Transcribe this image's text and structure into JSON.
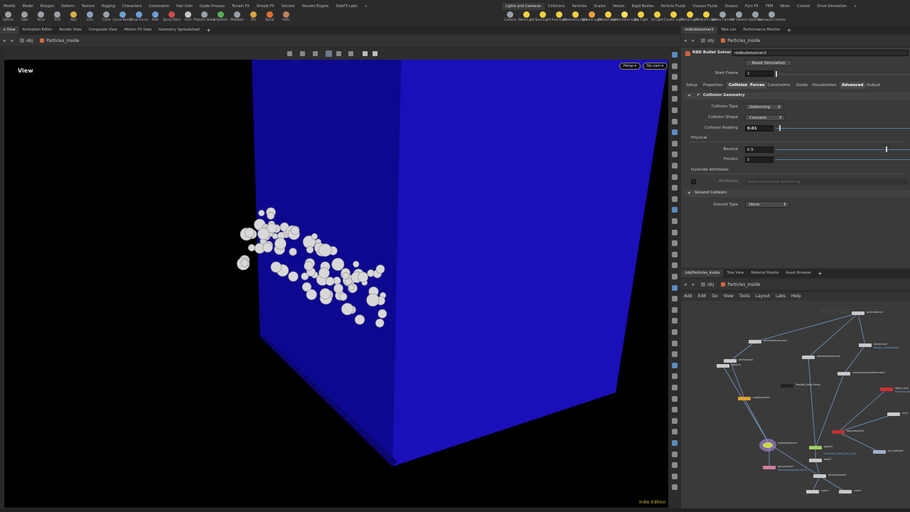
{
  "shelf_tabs_left": [
    "Modify",
    "Model",
    "Polygon",
    "Deform",
    "Texture",
    "Rigging",
    "Characters",
    "Constraints",
    "Hair Utils",
    "Guide Process",
    "Terrain FX",
    "Simple FX",
    "Volume",
    "Houdini Engine",
    "SideFX Labs",
    "+"
  ],
  "shelf_tabs_right": [
    "Lights and Cameras",
    "Collisions",
    "Particles",
    "Grains",
    "Vellum",
    "Rigid Bodies",
    "Particle Fluids",
    "Viscous Fluids",
    "Oceans",
    "Pyro FX",
    "FEM",
    "Wires",
    "Crowds",
    "Drive Simulation",
    "+"
  ],
  "tools_left": [
    {
      "label": "Sphere",
      "color": "#9aa0a8"
    },
    {
      "label": "Tube",
      "color": "#9aa0a8"
    },
    {
      "label": "Torus",
      "color": "#9aa0a8"
    },
    {
      "label": "Grid",
      "color": "#9aa0a8"
    },
    {
      "label": "Null",
      "color": "#d8b040"
    },
    {
      "label": "Line",
      "color": "#8aa0c0"
    },
    {
      "label": "Circle",
      "color": "#9aa0a8"
    },
    {
      "label": "Curve Bezier",
      "color": "#6aa0d0"
    },
    {
      "label": "Draw Curve",
      "color": "#6aa0d0"
    },
    {
      "label": "Path",
      "color": "#6aa0d0"
    },
    {
      "label": "Spray Paint",
      "color": "#d04a4a"
    },
    {
      "label": "Font",
      "color": "#c8c8c8"
    },
    {
      "label": "Platonic Solids",
      "color": "#9aa0a8"
    },
    {
      "label": "L-System",
      "color": "#5ab05a"
    },
    {
      "label": "Metaball",
      "color": "#9aa0a8"
    },
    {
      "label": "File",
      "color": "#d8a040"
    },
    {
      "label": "Spiral",
      "color": "#e07030"
    },
    {
      "label": "Helix",
      "color": "#c08060"
    }
  ],
  "tools_right": [
    {
      "label": "Camera",
      "color": "#9aa0a8"
    },
    {
      "label": "Point Light",
      "color": "#f0d040"
    },
    {
      "label": "Spot Light",
      "color": "#f0d040"
    },
    {
      "label": "Area Light",
      "color": "#f0d040"
    },
    {
      "label": "Geometry Light",
      "color": "#f0d040"
    },
    {
      "label": "Volume Light",
      "color": "#f0a040"
    },
    {
      "label": "Distant Light",
      "color": "#f0d040"
    },
    {
      "label": "Environment Light",
      "color": "#f0e060"
    },
    {
      "label": "Sky Light",
      "color": "#f0d040"
    },
    {
      "label": "GI Light",
      "color": "#f0d040"
    },
    {
      "label": "Caustic Light",
      "color": "#f0d040"
    },
    {
      "label": "Portal Light",
      "color": "#f0d040"
    },
    {
      "label": "Ambient Light",
      "color": "#f0d040"
    },
    {
      "label": "Stereo Camera",
      "color": "#9aa0a8"
    },
    {
      "label": "VR Camera",
      "color": "#9aa0a8"
    },
    {
      "label": "Switcher",
      "color": "#9aa0a8"
    },
    {
      "label": "Gamepad Camera",
      "color": "#9aa0a8"
    }
  ],
  "viewer_tabs": [
    "e View",
    "Animation Editor",
    "Render View",
    "Composite View",
    "Motion FX View",
    "Geometry Spreadsheet",
    "+"
  ],
  "viewer_path": [
    "obj",
    "Particles_Inside"
  ],
  "viewport": {
    "label": "View",
    "persp": "Persp ▾",
    "camera": "No cam ▾",
    "edition": "Indie Edition"
  },
  "param_tabs": [
    "rbdbulletsolver2",
    "Take List",
    "Performance Monitor",
    "+"
  ],
  "node_header": {
    "type": "RBD Bullet Solver",
    "name": "rbdbulletsolver2"
  },
  "params": {
    "reset_label": "Reset Simulation",
    "start_frame_label": "Start Frame",
    "start_frame": "1",
    "tabs": [
      "Setup",
      "Properties",
      "Collision",
      "Forces",
      "Constraints",
      "Guide",
      "Visualization",
      "Advanced",
      "Output"
    ],
    "collision_geometry": "Collision Geometry",
    "collision_type_label": "Collision Type",
    "collision_type": "Deforming",
    "collision_shape_label": "Collision Shape",
    "collision_shape": "Concave",
    "collision_padding_label": "Collision Padding",
    "collision_padding": "0.01",
    "physical_label": "Physical",
    "bounce_label": "Bounce",
    "bounce": "0.5",
    "bounce_fraction": 0.5,
    "friction_label": "Friction",
    "friction": "1",
    "override_label": "Override Attributes",
    "attributes_label": "Attributes",
    "attributes_value": "active animated deforming",
    "ground_collision": "Ground Collision",
    "ground_type_label": "Ground Type",
    "ground_type": "None"
  },
  "net_tabs": [
    "/obj/Particles_Inside",
    "Tree View",
    "Material Palette",
    "Asset Browser",
    "+"
  ],
  "net_path": [
    "obj",
    "Particles_Inside"
  ],
  "net_menu": [
    "Add",
    "Edit",
    "Go",
    "View",
    "Tools",
    "Layout",
    "Labs",
    "Help"
  ],
  "net_watermark": "Indie Ed",
  "nodes": [
    {
      "name": "pointdeform2",
      "color": "#c8c8c8",
      "note": ""
    },
    {
      "name": "pointsfromvolume1",
      "color": "#c8c8c8",
      "note": ""
    },
    {
      "name": "attribrand1",
      "color": "#c8c8c8",
      "note": "density_temperature"
    },
    {
      "name": "attribnoise2",
      "color": "#c8c8c8",
      "note": ""
    },
    {
      "name": "pointsfromvolume2",
      "color": "#c8c8c8",
      "note": ""
    },
    {
      "name": "sphere1",
      "color": "#c8c8c8",
      "note": ""
    },
    {
      "name": "volumerasterizeattributes1",
      "color": "#c8c8c8",
      "note": ""
    },
    {
      "name": "Tealight_Glow_Portal",
      "color": "#222222",
      "note": ""
    },
    {
      "name": "copytopoints2",
      "color": "#e0a030",
      "note": ""
    },
    {
      "name": "object_mer",
      "color": "#d03030",
      "note": "Pyramid_Inside"
    },
    {
      "name": "rbdbulletsolver2",
      "color": "#c8d850",
      "note": ""
    },
    {
      "name": "popnet",
      "color": "#a0d060",
      "note": "",
      "extra": "sub shoes_intro_first_input"
    },
    {
      "name": "dopnetsolver1",
      "color": "#c03030",
      "note": ""
    },
    {
      "name": "out_subtract",
      "color": "#a0b0c8",
      "note": ""
    },
    {
      "name": "blast1",
      "color": "#c8c8c8",
      "note": ""
    },
    {
      "name": "attributenoise1",
      "color": "#c8c8c8",
      "note": ""
    },
    {
      "name": "rop_alembic1",
      "color": "#d080a0",
      "note": "Simulation/sphere-fluids-..."
    },
    {
      "name": "color1",
      "color": "#c8c8c8",
      "note": ""
    },
    {
      "name": "color2",
      "color": "#c8c8c8",
      "note": ""
    },
    {
      "name": "null1",
      "color": "#c8c8c8",
      "note": ""
    }
  ],
  "colors": {
    "cube_front": "#1a0fb8",
    "cube_left": "#0e0890",
    "cube_bottom": "#0a0770",
    "accent": "#5b7ba8"
  }
}
